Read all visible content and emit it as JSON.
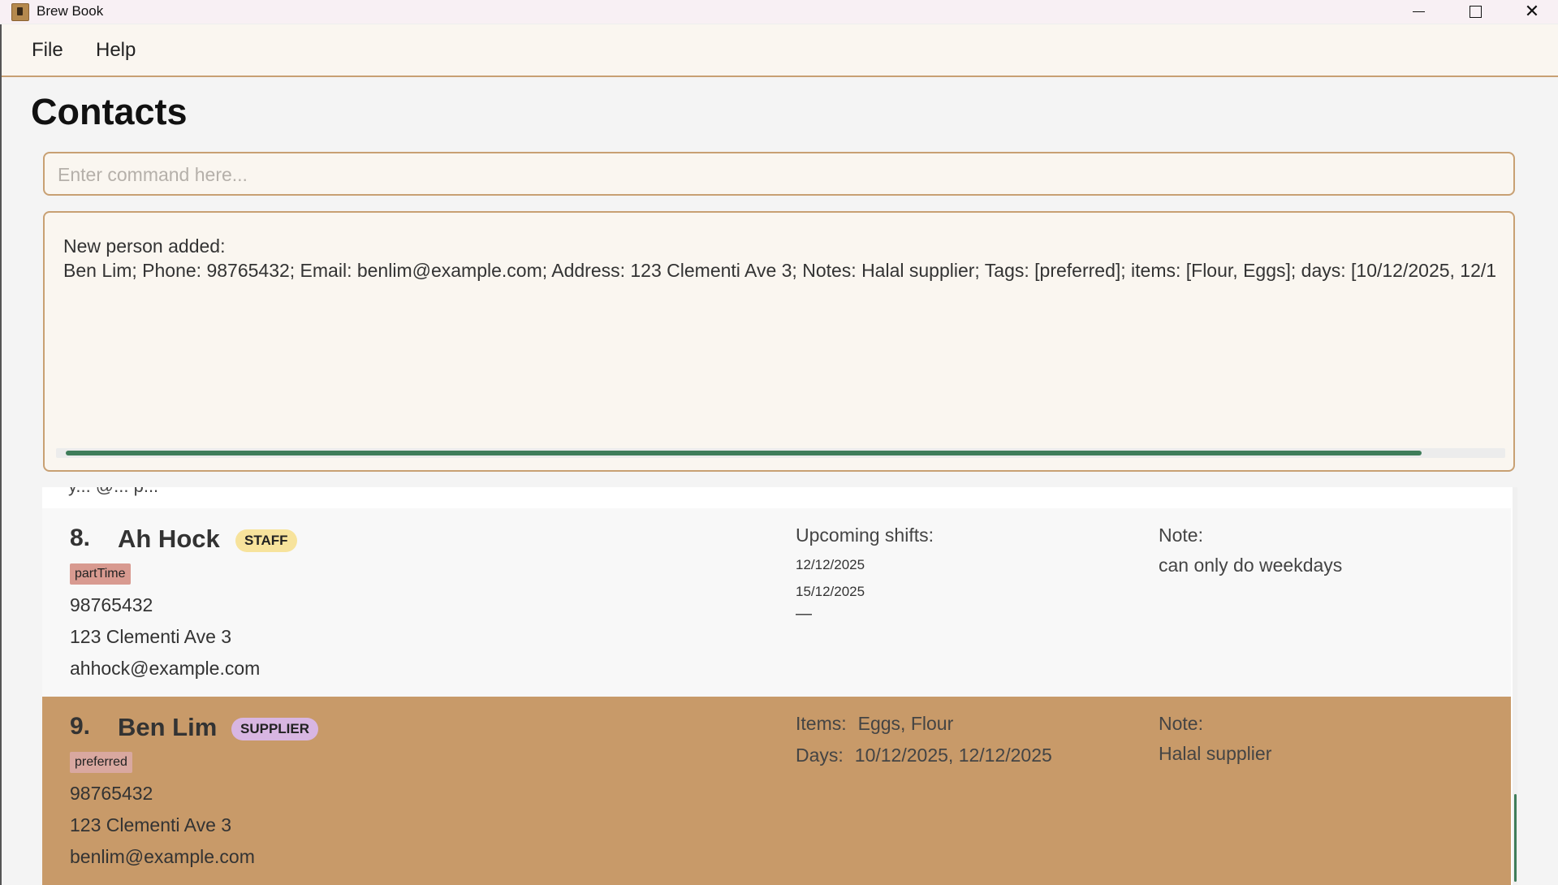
{
  "window": {
    "title": "Brew Book",
    "controls": {
      "minimize_icon": "minimize-icon",
      "maximize_icon": "maximize-icon",
      "close_icon": "close-icon"
    }
  },
  "menu": {
    "items": [
      {
        "label": "File"
      },
      {
        "label": "Help"
      }
    ]
  },
  "page": {
    "title": "Contacts"
  },
  "command": {
    "placeholder": "Enter command here...",
    "value": ""
  },
  "result": {
    "lines": [
      "New person added:",
      "Ben Lim; Phone: 98765432; Email: benlim@example.com; Address: 123 Clementi Ave 3; Notes: Halal supplier; Tags: [preferred]; items: [Flour, Eggs]; days: [10/12/2025, 12/1"
    ]
  },
  "list": {
    "cut_text": "y... @... p...",
    "contacts": [
      {
        "index": "8.",
        "name": "Ah Hock",
        "role": "STAFF",
        "tag": "partTime",
        "phone": "98765432",
        "address": "123 Clementi Ave 3",
        "email": "ahhock@example.com",
        "shifts_label": "Upcoming shifts:",
        "shifts": [
          "12/12/2025",
          "15/12/2025"
        ],
        "shift_more": "—",
        "note_label": "Note:",
        "note": "can only do weekdays"
      },
      {
        "index": "9.",
        "name": "Ben Lim",
        "role": "SUPPLIER",
        "tag": "preferred",
        "phone": "98765432",
        "address": "123 Clementi Ave 3",
        "email": "benlim@example.com",
        "items_label": "Items:",
        "items": "Eggs, Flour",
        "days_label": "Days:",
        "days": "10/12/2025, 12/12/2025",
        "note_label": "Note:",
        "note": "Halal supplier"
      }
    ]
  },
  "colors": {
    "accent_border": "#c8a073",
    "selected_card": "#c89a69",
    "scroll_thumb": "#3f7d5a",
    "staff_badge": "#f7e39c",
    "supplier_badge": "#d8b6e2"
  }
}
